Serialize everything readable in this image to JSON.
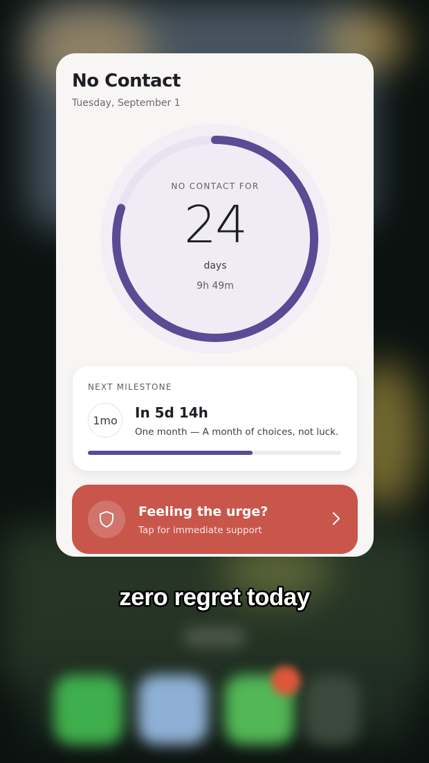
{
  "widget": {
    "title": "No Contact",
    "date": "Tuesday, September 1"
  },
  "counter": {
    "label": "NO CONTACT FOR",
    "value": "24",
    "unit": "days",
    "sub": "9h 49m",
    "ring_progress": 0.8
  },
  "milestone": {
    "label": "NEXT MILESTONE",
    "badge": "1mo",
    "time": "In 5d 14h",
    "description": "One month — A month of choices, not luck.",
    "progress": 0.65
  },
  "urge_button": {
    "title": "Feeling the urge?",
    "subtitle": "Tap for immediate support",
    "icon": "shield-icon"
  },
  "caption": "zero regret today",
  "colors": {
    "accent": "#5b4a94",
    "urge": "#c9564b",
    "card": "#f8f6f4"
  }
}
